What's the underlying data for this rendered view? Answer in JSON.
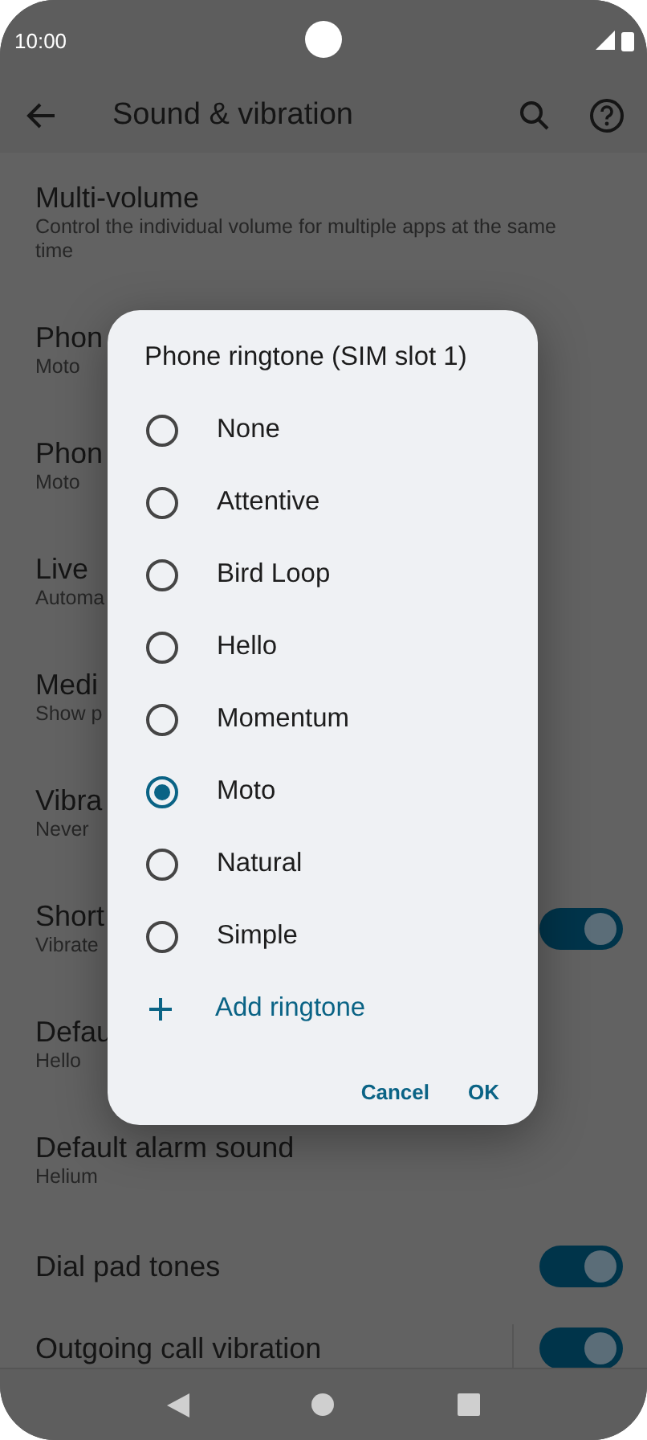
{
  "status_bar": {
    "time": "10:00"
  },
  "app_bar": {
    "title": "Sound & vibration"
  },
  "settings": [
    {
      "title": "Multi-volume",
      "subtitle": "Control the individual volume for multiple apps at the same time"
    },
    {
      "title": "Phon",
      "subtitle": "Moto"
    },
    {
      "title": "Phon",
      "subtitle": "Moto"
    },
    {
      "title": "Live",
      "subtitle": "Automa"
    },
    {
      "title": "Medi",
      "subtitle": "Show p"
    },
    {
      "title": "Vibra",
      "subtitle": "Never"
    },
    {
      "title": "Short",
      "subtitle": "Vibrate",
      "on": true
    },
    {
      "title": "Defau",
      "subtitle": "Hello"
    },
    {
      "title": "Default alarm sound",
      "subtitle": "Helium"
    },
    {
      "title": "Dial pad tones",
      "on": true
    },
    {
      "title": "Outgoing call vibration",
      "on": true
    }
  ],
  "dialog": {
    "title": "Phone ringtone (SIM slot 1)",
    "options": [
      {
        "label": "None",
        "selected": false
      },
      {
        "label": "Attentive",
        "selected": false
      },
      {
        "label": "Bird Loop",
        "selected": false
      },
      {
        "label": "Hello",
        "selected": false
      },
      {
        "label": "Momentum",
        "selected": false
      },
      {
        "label": "Moto",
        "selected": true
      },
      {
        "label": "Natural",
        "selected": false
      },
      {
        "label": "Simple",
        "selected": false
      }
    ],
    "add_action": "Add ringtone",
    "buttons": [
      "Cancel",
      "OK"
    ]
  }
}
